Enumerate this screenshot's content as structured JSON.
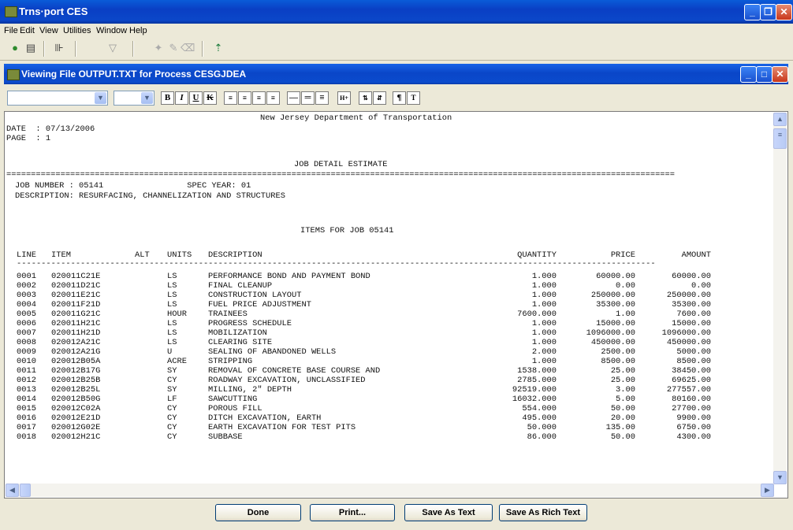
{
  "app": {
    "title": "Trns·port CES"
  },
  "menu": [
    "File",
    "Edit",
    "View",
    "Utilities",
    "Window",
    "Help"
  ],
  "child": {
    "title": "Viewing File OUTPUT.TXT for Process CESGJDEA"
  },
  "format": {
    "bold": "B",
    "italic": "I",
    "underline": "U",
    "strike": "K"
  },
  "report": {
    "agency": "New Jersey Department of Transportation",
    "date_line": "DATE  : 07/13/2006",
    "page_line": "PAGE  : 1",
    "heading": "JOB DETAIL ESTIMATE",
    "rule": "========================================================================================================================================",
    "job_line": "JOB NUMBER : 05141                 SPEC YEAR: 01",
    "desc_line": "DESCRIPTION: RESURFACING, CHANNELIZATION AND STRUCTURES",
    "items_heading": "ITEMS FOR JOB 05141",
    "columns": {
      "line": "LINE",
      "item": "ITEM",
      "alt": "ALT",
      "units": "UNITS",
      "description": "DESCRIPTION",
      "quantity": "QUANTITY",
      "price": "PRICE",
      "amount": "AMOUNT"
    },
    "dash_rule": "----------------------------------------------------------------------------------------------------------------------------------",
    "rows": [
      {
        "line": "0001",
        "item": "020011C21E",
        "units": "LS",
        "description": "PERFORMANCE BOND AND PAYMENT BOND",
        "quantity": "1.000",
        "price": "60000.00",
        "amount": "60000.00"
      },
      {
        "line": "0002",
        "item": "020011D21C",
        "units": "LS",
        "description": "FINAL CLEANUP",
        "quantity": "1.000",
        "price": "0.00",
        "amount": "0.00"
      },
      {
        "line": "0003",
        "item": "020011E21C",
        "units": "LS",
        "description": "CONSTRUCTION LAYOUT",
        "quantity": "1.000",
        "price": "250000.00",
        "amount": "250000.00"
      },
      {
        "line": "0004",
        "item": "020011F21D",
        "units": "LS",
        "description": "FUEL PRICE ADJUSTMENT",
        "quantity": "1.000",
        "price": "35300.00",
        "amount": "35300.00"
      },
      {
        "line": "0005",
        "item": "020011G21C",
        "units": "HOUR",
        "description": "TRAINEES",
        "quantity": "7600.000",
        "price": "1.00",
        "amount": "7600.00"
      },
      {
        "line": "0006",
        "item": "020011H21C",
        "units": "LS",
        "description": "PROGRESS SCHEDULE",
        "quantity": "1.000",
        "price": "15000.00",
        "amount": "15000.00"
      },
      {
        "line": "0007",
        "item": "020011H21D",
        "units": "LS",
        "description": "MOBILIZATION",
        "quantity": "1.000",
        "price": "1096000.00",
        "amount": "1096000.00"
      },
      {
        "line": "0008",
        "item": "020012A21C",
        "units": "LS",
        "description": "CLEARING SITE",
        "quantity": "1.000",
        "price": "450000.00",
        "amount": "450000.00"
      },
      {
        "line": "0009",
        "item": "020012A21G",
        "units": "U",
        "description": "SEALING OF ABANDONED WELLS",
        "quantity": "2.000",
        "price": "2500.00",
        "amount": "5000.00"
      },
      {
        "line": "0010",
        "item": "020012B05A",
        "units": "ACRE",
        "description": "STRIPPING",
        "quantity": "1.000",
        "price": "8500.00",
        "amount": "8500.00"
      },
      {
        "line": "0011",
        "item": "020012B17G",
        "units": "SY",
        "description": "REMOVAL OF CONCRETE BASE COURSE AND",
        "quantity": "1538.000",
        "price": "25.00",
        "amount": "38450.00"
      },
      {
        "line": "0012",
        "item": "020012B25B",
        "units": "CY",
        "description": "ROADWAY EXCAVATION, UNCLASSIFIED",
        "quantity": "2785.000",
        "price": "25.00",
        "amount": "69625.00"
      },
      {
        "line": "0013",
        "item": "020012B25L",
        "units": "SY",
        "description": "MILLING, 2\" DEPTH",
        "quantity": "92519.000",
        "price": "3.00",
        "amount": "277557.00"
      },
      {
        "line": "0014",
        "item": "020012B50G",
        "units": "LF",
        "description": "SAWCUTTING",
        "quantity": "16032.000",
        "price": "5.00",
        "amount": "80160.00"
      },
      {
        "line": "0015",
        "item": "020012C02A",
        "units": "CY",
        "description": "POROUS FILL",
        "quantity": "554.000",
        "price": "50.00",
        "amount": "27700.00"
      },
      {
        "line": "0016",
        "item": "020012E21D",
        "units": "CY",
        "description": "DITCH EXCAVATION, EARTH",
        "quantity": "495.000",
        "price": "20.00",
        "amount": "9900.00"
      },
      {
        "line": "0017",
        "item": "020012G02E",
        "units": "CY",
        "description": "EARTH EXCAVATION FOR TEST PITS",
        "quantity": "50.000",
        "price": "135.00",
        "amount": "6750.00"
      },
      {
        "line": "0018",
        "item": "020012H21C",
        "units": "CY",
        "description": "SUBBASE",
        "quantity": "86.000",
        "price": "50.00",
        "amount": "4300.00"
      }
    ]
  },
  "buttons": {
    "done": "Done",
    "print": "Print...",
    "save_text": "Save As Text",
    "save_rich": "Save As Rich Text"
  }
}
